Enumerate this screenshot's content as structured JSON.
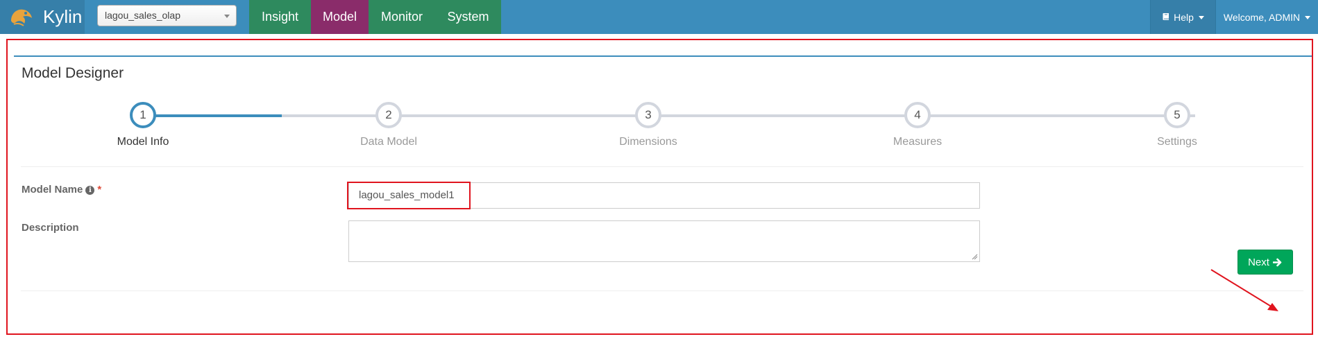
{
  "navbar": {
    "brand": "Kylin",
    "project_select": "lagou_sales_olap",
    "tabs": [
      {
        "label": "Insight"
      },
      {
        "label": "Model"
      },
      {
        "label": "Monitor"
      },
      {
        "label": "System"
      }
    ],
    "active_tab": "Model",
    "help_label": "Help",
    "welcome_label": "Welcome, ADMIN"
  },
  "panel": {
    "title": "Model Designer"
  },
  "wizard": {
    "steps": [
      {
        "number": "1",
        "label": "Model Info"
      },
      {
        "number": "2",
        "label": "Data Model"
      },
      {
        "number": "3",
        "label": "Dimensions"
      },
      {
        "number": "4",
        "label": "Measures"
      },
      {
        "number": "5",
        "label": "Settings"
      }
    ],
    "active_step": 1
  },
  "form": {
    "model_name_label": "Model Name",
    "model_name_value": "lagou_sales_model1",
    "required_mark": "*",
    "description_label": "Description",
    "description_value": ""
  },
  "actions": {
    "next_label": "Next"
  },
  "colors": {
    "navbar": "#3c8dbc",
    "model_tab": "#8a2c6a",
    "green_tab": "#2e8a5e",
    "next_button": "#00a65a",
    "annotation": "#e0141e"
  },
  "icons": {
    "brand": "kylin-logo-icon",
    "help": "book-icon",
    "info": "info-circle-icon",
    "next": "arrow-right-icon"
  }
}
